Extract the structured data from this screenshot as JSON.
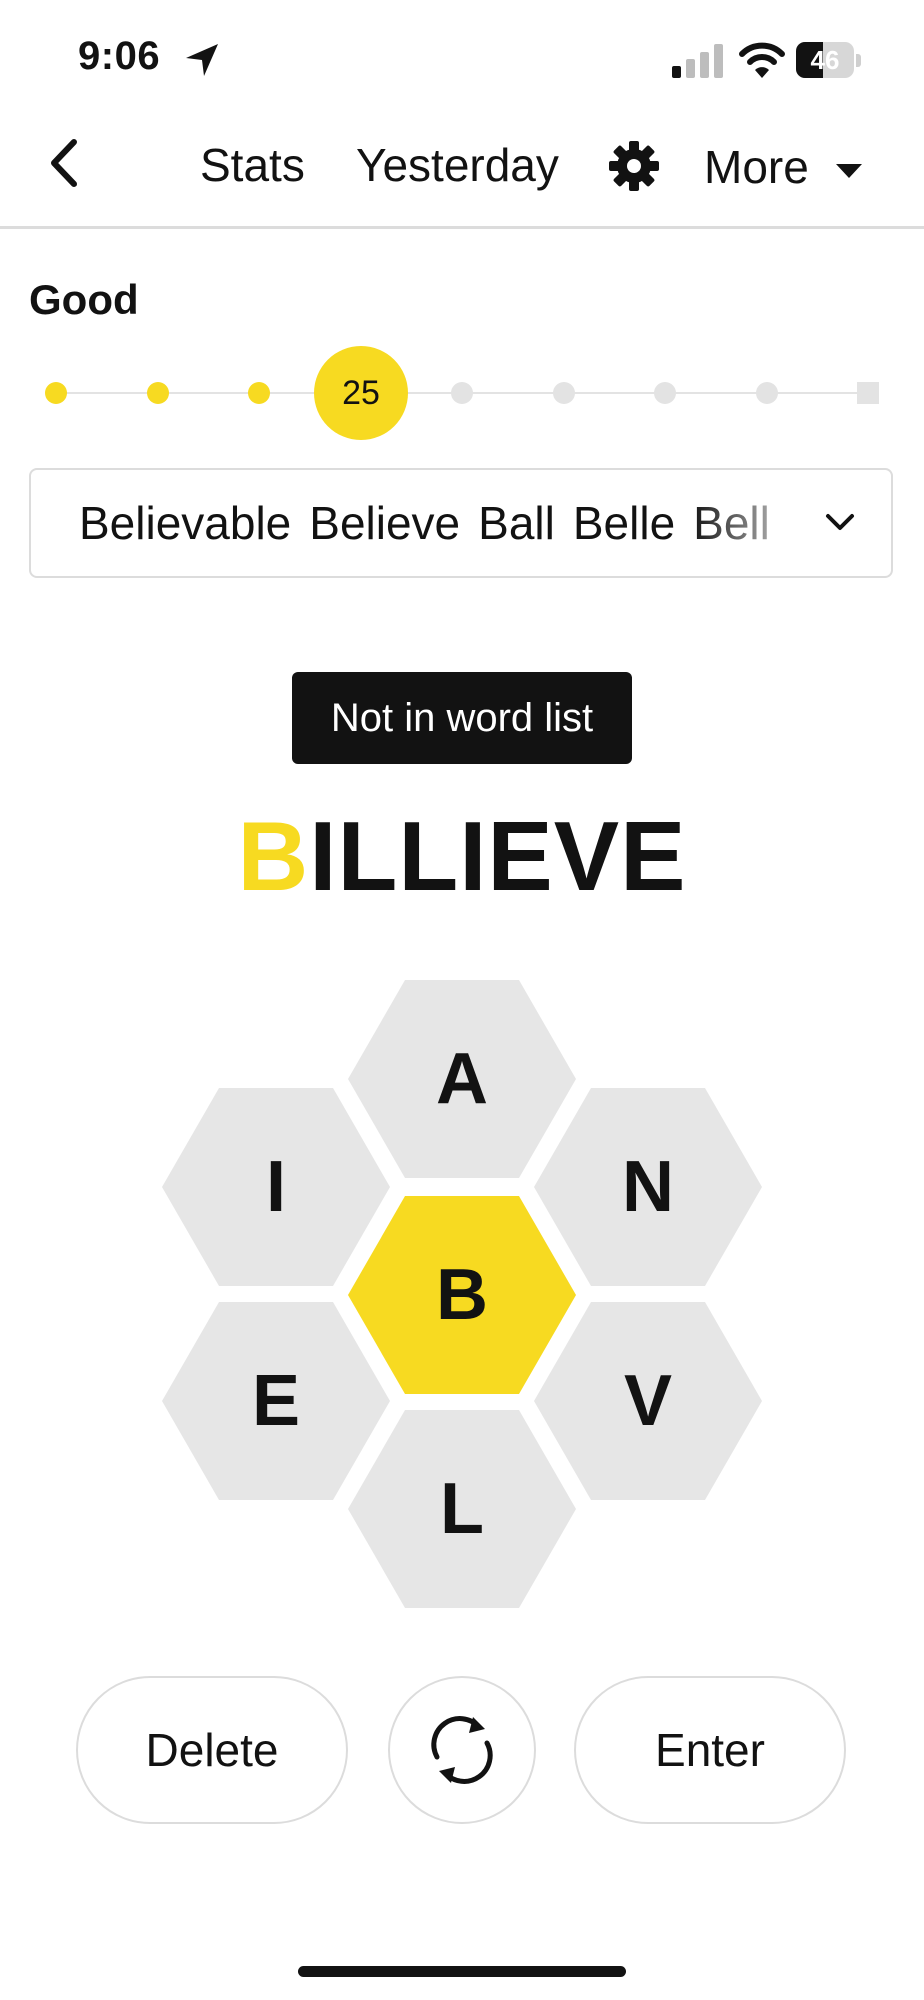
{
  "status_bar": {
    "time": "9:06",
    "battery_level": "46",
    "battery_fraction": 0.46
  },
  "nav": {
    "stats": "Stats",
    "yesterday": "Yesterday",
    "more": "More"
  },
  "rank": {
    "label": "Good",
    "score": "25",
    "current_step": 4,
    "total_steps": 9
  },
  "found_words": [
    "Believable",
    "Believe",
    "Ball",
    "Belle",
    "Bell"
  ],
  "message": "Not in word list",
  "current_input": {
    "center": "B",
    "rest": "ILLIEVE"
  },
  "hive": {
    "center": "B",
    "top": "A",
    "upper_left": "I",
    "upper_right": "N",
    "lower_left": "E",
    "lower_right": "V",
    "bottom": "L"
  },
  "controls": {
    "delete": "Delete",
    "enter": "Enter"
  },
  "colors": {
    "accent_yellow": "#f7da21",
    "cell_gray": "#e6e6e6",
    "text": "#121212",
    "border": "#dcdcdc"
  },
  "icons": {
    "back": "chevron-left-icon",
    "settings": "gear-icon",
    "more": "caret-down-icon",
    "expand": "chevron-down-icon",
    "shuffle": "shuffle-icon",
    "location": "location-arrow-icon"
  }
}
